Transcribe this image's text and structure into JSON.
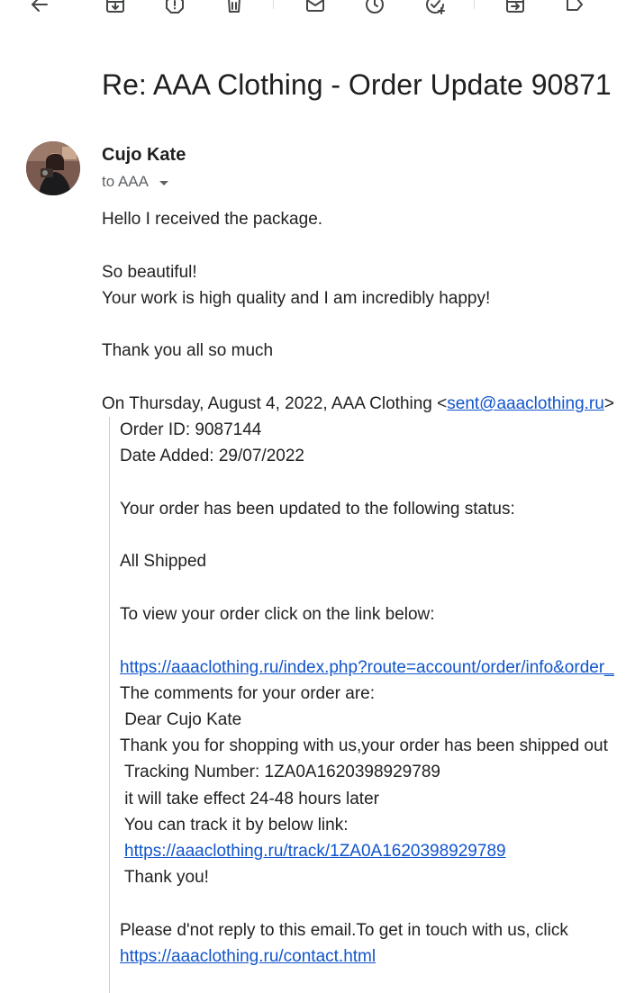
{
  "toolbar": {
    "icons": [
      "back-arrow-icon",
      "archive-icon",
      "report-spam-icon",
      "delete-icon",
      "mark-unread-icon",
      "snooze-icon",
      "add-to-tasks-icon",
      "move-to-icon",
      "label-icon"
    ]
  },
  "subject": "Re: AAA Clothing - Order Update 90871",
  "sender": {
    "name": "Cujo Kate",
    "to_label": "to AAA"
  },
  "reply": {
    "line1": "Hello I received the package.",
    "line2": "So beautiful!",
    "line3": "Your work is high quality and I am incredibly happy!",
    "line4": "Thank you all so much"
  },
  "quote_header": {
    "prefix": "On Thursday, August 4, 2022, AAA Clothing <",
    "email": "sent@aaaclothing.ru",
    "suffix": ">"
  },
  "quoted": {
    "order_id": "Order ID: 9087144",
    "date_added": "Date Added: 29/07/2022",
    "status_intro": "Your order has been updated to the following status:",
    "status": "All Shipped",
    "view_intro": "To view your order click on the link below:",
    "order_link": "https://aaaclothing.ru/index.php?route=account/order/info&order_",
    "comments_intro": "The comments for your order are:",
    "dear": " Dear Cujo Kate",
    "shipped": "Thank you for shopping with us,your order has been shipped out",
    "tracking": " Tracking Number: 1ZA0A1620398929789",
    "effect": " it will take effect 24-48 hours later",
    "track_intro": " You can track it by below link:",
    "track_link": "https://aaaclothing.ru/track/1ZA0A1620398929789",
    "thanks": " Thank you!",
    "no_reply": "Please d'not reply to this email.To get in touch with us, click",
    "contact_link": "https://aaaclothing.ru/contact.html"
  }
}
